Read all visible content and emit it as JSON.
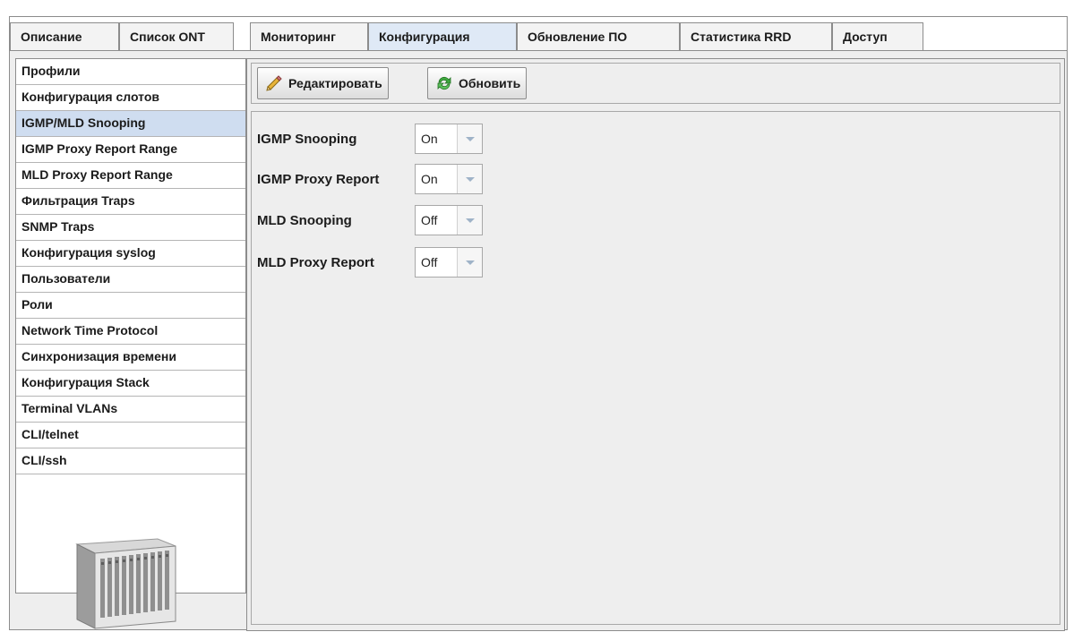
{
  "tabs": [
    {
      "label": "Описание"
    },
    {
      "label": "Список ONT"
    },
    {
      "label": "Мониторинг"
    },
    {
      "label": "Конфигурация"
    },
    {
      "label": "Обновление ПО"
    },
    {
      "label": "Статистика RRD"
    },
    {
      "label": "Доступ"
    }
  ],
  "active_tab": "Конфигурация",
  "menu": {
    "items": [
      {
        "label": "Профили"
      },
      {
        "label": "Конфигурация слотов"
      },
      {
        "label": "IGMP/MLD Snooping"
      },
      {
        "label": "IGMP Proxy Report Range"
      },
      {
        "label": "MLD Proxy Report Range"
      },
      {
        "label": "Фильтрация Traps"
      },
      {
        "label": "SNMP Traps"
      },
      {
        "label": "Конфигурация syslog"
      },
      {
        "label": "Пользователи"
      },
      {
        "label": "Роли"
      },
      {
        "label": "Network Time Protocol"
      },
      {
        "label": "Синхронизация времени"
      },
      {
        "label": "Конфигурация Stack"
      },
      {
        "label": "Terminal VLANs"
      },
      {
        "label": "CLI/telnet"
      },
      {
        "label": "CLI/ssh"
      }
    ],
    "active": "IGMP/MLD Snooping",
    "device_image": "chassis-device-icon"
  },
  "toolbar": {
    "edit_label": "Редактировать",
    "edit_icon": "pencil-icon",
    "refresh_label": "Обновить",
    "refresh_icon": "refresh-icon"
  },
  "settings": [
    {
      "label": "IGMP Snooping",
      "value": "On"
    },
    {
      "label": "IGMP Proxy Report",
      "value": "On"
    },
    {
      "label": "MLD Snooping",
      "value": "Off"
    },
    {
      "label": "MLD Proxy Report",
      "value": "Off"
    }
  ],
  "colors": {
    "active_highlight": "#cfddf0",
    "active_tab": "#dfe9f6",
    "panel_bg": "#eeeeee",
    "border": "#8c8c8c"
  }
}
